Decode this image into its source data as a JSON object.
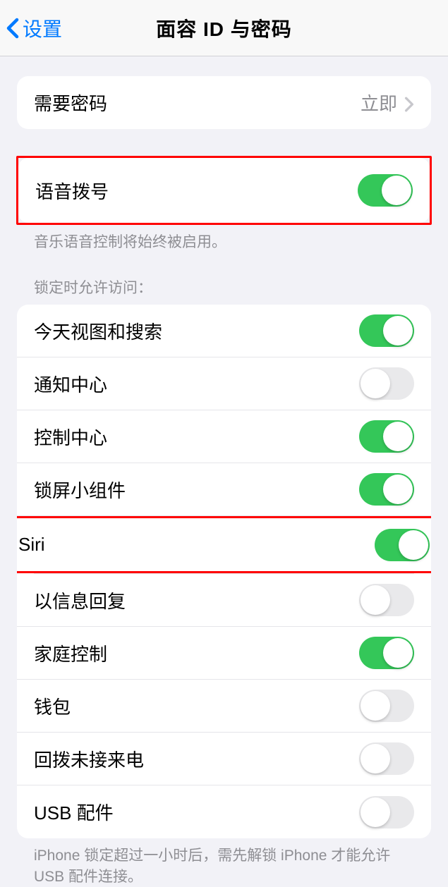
{
  "header": {
    "back_label": "设置",
    "title": "面容 ID 与密码"
  },
  "passcode_row": {
    "label": "需要密码",
    "value": "立即"
  },
  "voice_dial": {
    "label": "语音拨号",
    "footer": "音乐语音控制将始终被启用。"
  },
  "lock_section": {
    "header": "锁定时允许访问：",
    "items": [
      {
        "label": "今天视图和搜索",
        "on": true
      },
      {
        "label": "通知中心",
        "on": false
      },
      {
        "label": "控制中心",
        "on": true
      },
      {
        "label": "锁屏小组件",
        "on": true
      },
      {
        "label": "Siri",
        "on": true
      },
      {
        "label": "以信息回复",
        "on": false
      },
      {
        "label": "家庭控制",
        "on": true
      },
      {
        "label": "钱包",
        "on": false
      },
      {
        "label": "回拨未接来电",
        "on": false
      },
      {
        "label": "USB 配件",
        "on": false
      }
    ],
    "footer": "iPhone 锁定超过一小时后，需先解锁 iPhone 才能允许 USB 配件连接。"
  }
}
